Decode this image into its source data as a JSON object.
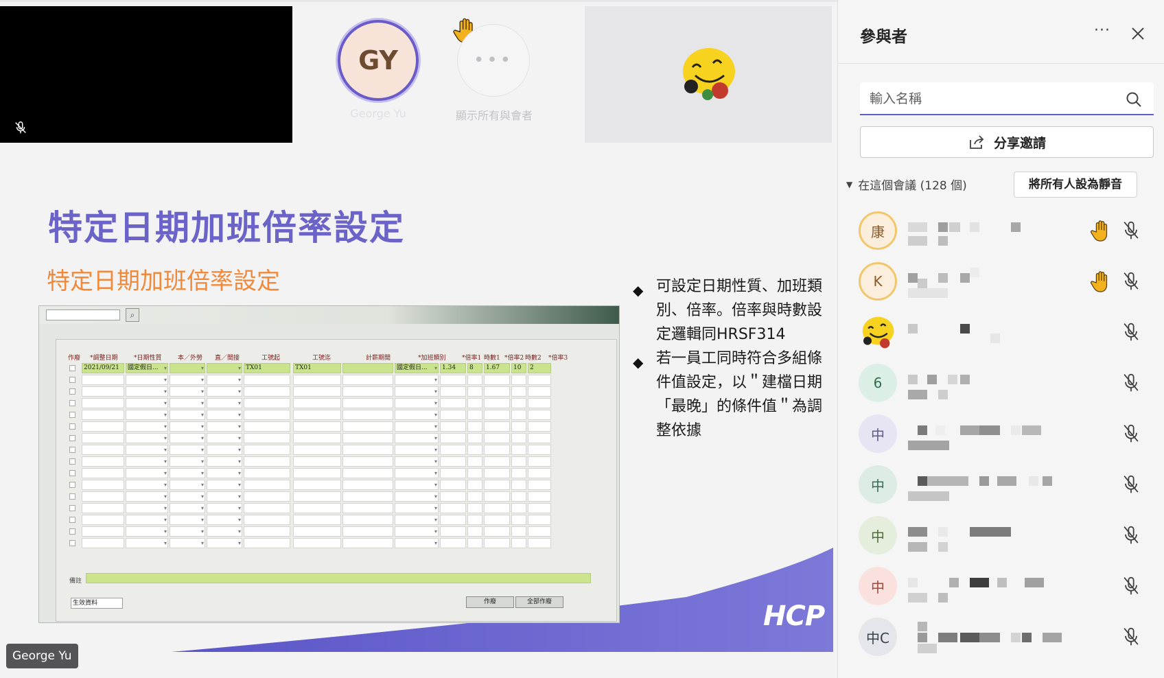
{
  "stage": {
    "top_tiles": {
      "gy_initials": "GY",
      "gy_name": "George Yu",
      "more_name": "顯示所有與會者"
    },
    "slide": {
      "title": "特定日期加班倍率設定",
      "subtitle": "特定日期加班倍率設定",
      "bullets": [
        "可設定日期性質、加班類別、倍率。倍率與時數設定邏輯同HRSF314",
        "若一員工同時符合多組條件值設定，以＂建檔日期「最晚」的條件值＂為調整依據"
      ],
      "logo": "HCP",
      "screenshot": {
        "headers": [
          "作廢",
          "*調整日期",
          "*日期性質",
          "本／外勞",
          "直／間接",
          "工號起",
          "工號迄",
          "計薪期間",
          "*加班類別",
          "*倍率1",
          "時數1",
          "*倍率2",
          "時數2",
          "*倍率3"
        ],
        "first_row": [
          "2021/09/21",
          "國定假日...",
          "",
          "",
          "TX01",
          "TX01",
          "",
          "國定假日...",
          "1.34",
          "8",
          "1.67",
          "10",
          "2"
        ],
        "note_label": "備註",
        "select_value": "生效資料",
        "btn_void": "作廢",
        "btn_void_all": "全部作廢"
      }
    },
    "presenter_tag": "George Yu"
  },
  "panel": {
    "title": "參與者",
    "search_placeholder": "輸入名稱",
    "share_label": "分享邀請",
    "section_label": "在這個會議 (128 個)",
    "mute_all_label": "將所有人設為靜音",
    "participants": [
      {
        "initial": "康",
        "bg": "#fbeedd",
        "fg": "#8a5a2b",
        "ring": true,
        "hand": true
      },
      {
        "initial": "K",
        "bg": "#fbeedd",
        "fg": "#8a5a2b",
        "ring": true,
        "hand": true
      },
      {
        "initial": "",
        "bg": "transparent",
        "fg": "#000",
        "ring": false,
        "hand": false,
        "emoji": true
      },
      {
        "initial": "6",
        "bg": "#dcefe4",
        "fg": "#2f6f4e",
        "ring": false,
        "hand": false
      },
      {
        "initial": "中",
        "bg": "#e7e4f3",
        "fg": "#5d5a88",
        "ring": false,
        "hand": false
      },
      {
        "initial": "中",
        "bg": "#dcebe4",
        "fg": "#3b6b58",
        "ring": false,
        "hand": false
      },
      {
        "initial": "中",
        "bg": "#e5eedc",
        "fg": "#4e6b3a",
        "ring": false,
        "hand": false
      },
      {
        "initial": "中",
        "bg": "#fbe1dd",
        "fg": "#9a4a3e",
        "ring": false,
        "hand": false
      },
      {
        "initial": "中C",
        "bg": "#e3e6ea",
        "fg": "#37414d",
        "ring": false,
        "hand": false
      }
    ],
    "colors": {
      "accent": "#5b5fc7",
      "hand": "#f2b11d",
      "title_purple": "#6b63c8",
      "subtitle_orange": "#f08a3a"
    }
  }
}
